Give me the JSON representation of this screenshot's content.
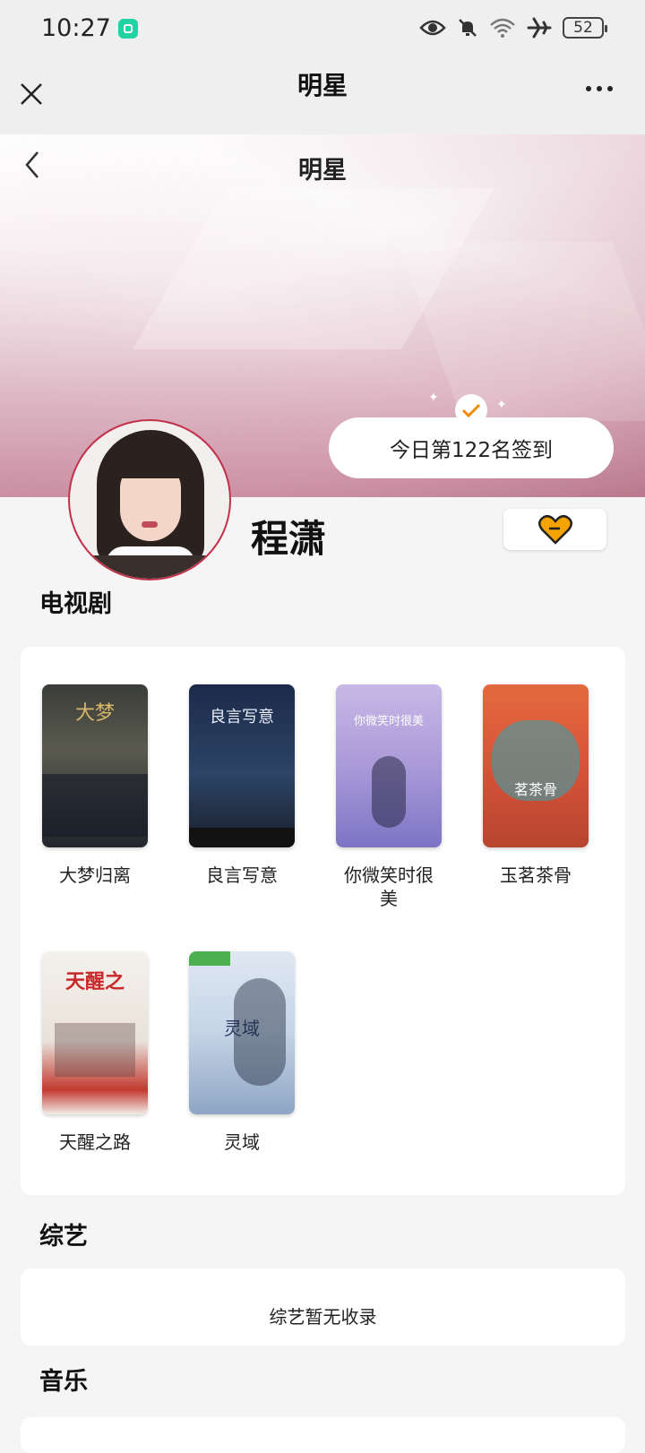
{
  "status_bar": {
    "time": "10:27",
    "battery": "52"
  },
  "top_nav": {
    "title": "明星"
  },
  "banner": {
    "title": "明星"
  },
  "checkin": {
    "label": "今日第122名签到"
  },
  "star": {
    "name": "程潇"
  },
  "sections": {
    "tv": {
      "title": "电视剧",
      "items": [
        {
          "label": "大梦归离"
        },
        {
          "label": "良言写意"
        },
        {
          "label": "你微笑时很美"
        },
        {
          "label": "玉茗茶骨"
        },
        {
          "label": "天醒之路"
        },
        {
          "label": "灵域"
        }
      ]
    },
    "variety": {
      "title": "综艺",
      "empty_text": "综艺暂无收录"
    },
    "music": {
      "title": "音乐"
    }
  },
  "colors": {
    "accent": "#f4a300",
    "avatar_border": "#c4304a"
  }
}
